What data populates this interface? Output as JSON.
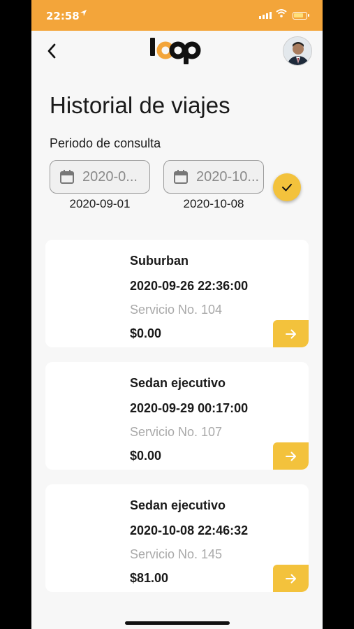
{
  "status_bar": {
    "time": "22:58"
  },
  "header": {
    "logo_text": "loop"
  },
  "page": {
    "title": "Historial de viajes",
    "period_label": "Periodo de consulta"
  },
  "filter": {
    "start": {
      "field_value": "2020-0...",
      "caption": "2020-09-01"
    },
    "end": {
      "field_value": "2020-10...",
      "caption": "2020-10-08"
    }
  },
  "trips": [
    {
      "vehicle": "Suburban",
      "datetime": "2020-09-26 22:36:00",
      "service": "Servicio No. 104",
      "price": "$0.00"
    },
    {
      "vehicle": "Sedan ejecutivo",
      "datetime": "2020-09-29 00:17:00",
      "service": "Servicio No. 107",
      "price": "$0.00"
    },
    {
      "vehicle": "Sedan ejecutivo",
      "datetime": "2020-10-08 22:46:32",
      "service": "Servicio No. 145",
      "price": "$81.00"
    }
  ],
  "colors": {
    "accent": "#f3a53a",
    "button": "#f3c23c",
    "background": "#f7f7f7"
  },
  "icons": [
    "back-arrow-icon",
    "calendar-icon",
    "check-icon",
    "arrow-right-icon",
    "location-arrow-icon",
    "wifi-icon",
    "battery-icon"
  ]
}
